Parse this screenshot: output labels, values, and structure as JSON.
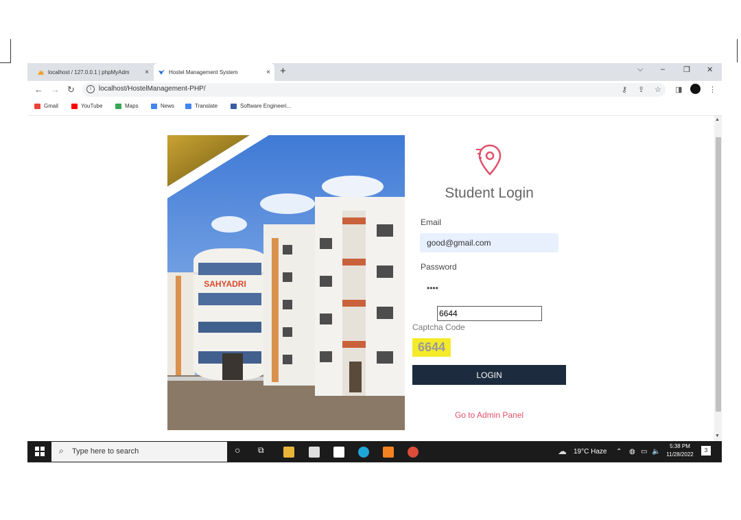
{
  "browser": {
    "tabs": [
      {
        "title": "localhost / 127.0.0.1 | phpMyAdm",
        "close": "×"
      },
      {
        "title": "Hostel Management System",
        "close": "×"
      }
    ],
    "new_tab": "+",
    "window_controls": {
      "menu": "⌵",
      "minimize": "–",
      "restore": "❐",
      "close": "✕"
    },
    "url": "localhost/HostelManagement-PHP/",
    "info": "i",
    "bookmarks": [
      "Gmail",
      "YouTube",
      "Maps",
      "News",
      "Translate",
      "Software Engineeri..."
    ]
  },
  "page": {
    "photo_sign": "SAHYADRI",
    "login": {
      "title": "Student Login",
      "email_label": "Email",
      "email_value": "good@gmail.com",
      "password_label": "Password",
      "password_value": "••••",
      "captcha_input_value": "6644",
      "captcha_label": "Captcha Code",
      "captcha_code": "6644",
      "login_button": "LOGIN",
      "admin_link": "Go to Admin Panel"
    }
  },
  "taskbar": {
    "search_placeholder": "Type here to search",
    "weather": "19°C  Haze",
    "time": "5:38 PM",
    "date": "11/28/2022",
    "notification_count": "3"
  },
  "colors": {
    "login_button": "#1c2b3d",
    "admin_link": "#e0506a",
    "captcha_highlight": "#f5ea2a",
    "location_icon": "#e0506a"
  }
}
